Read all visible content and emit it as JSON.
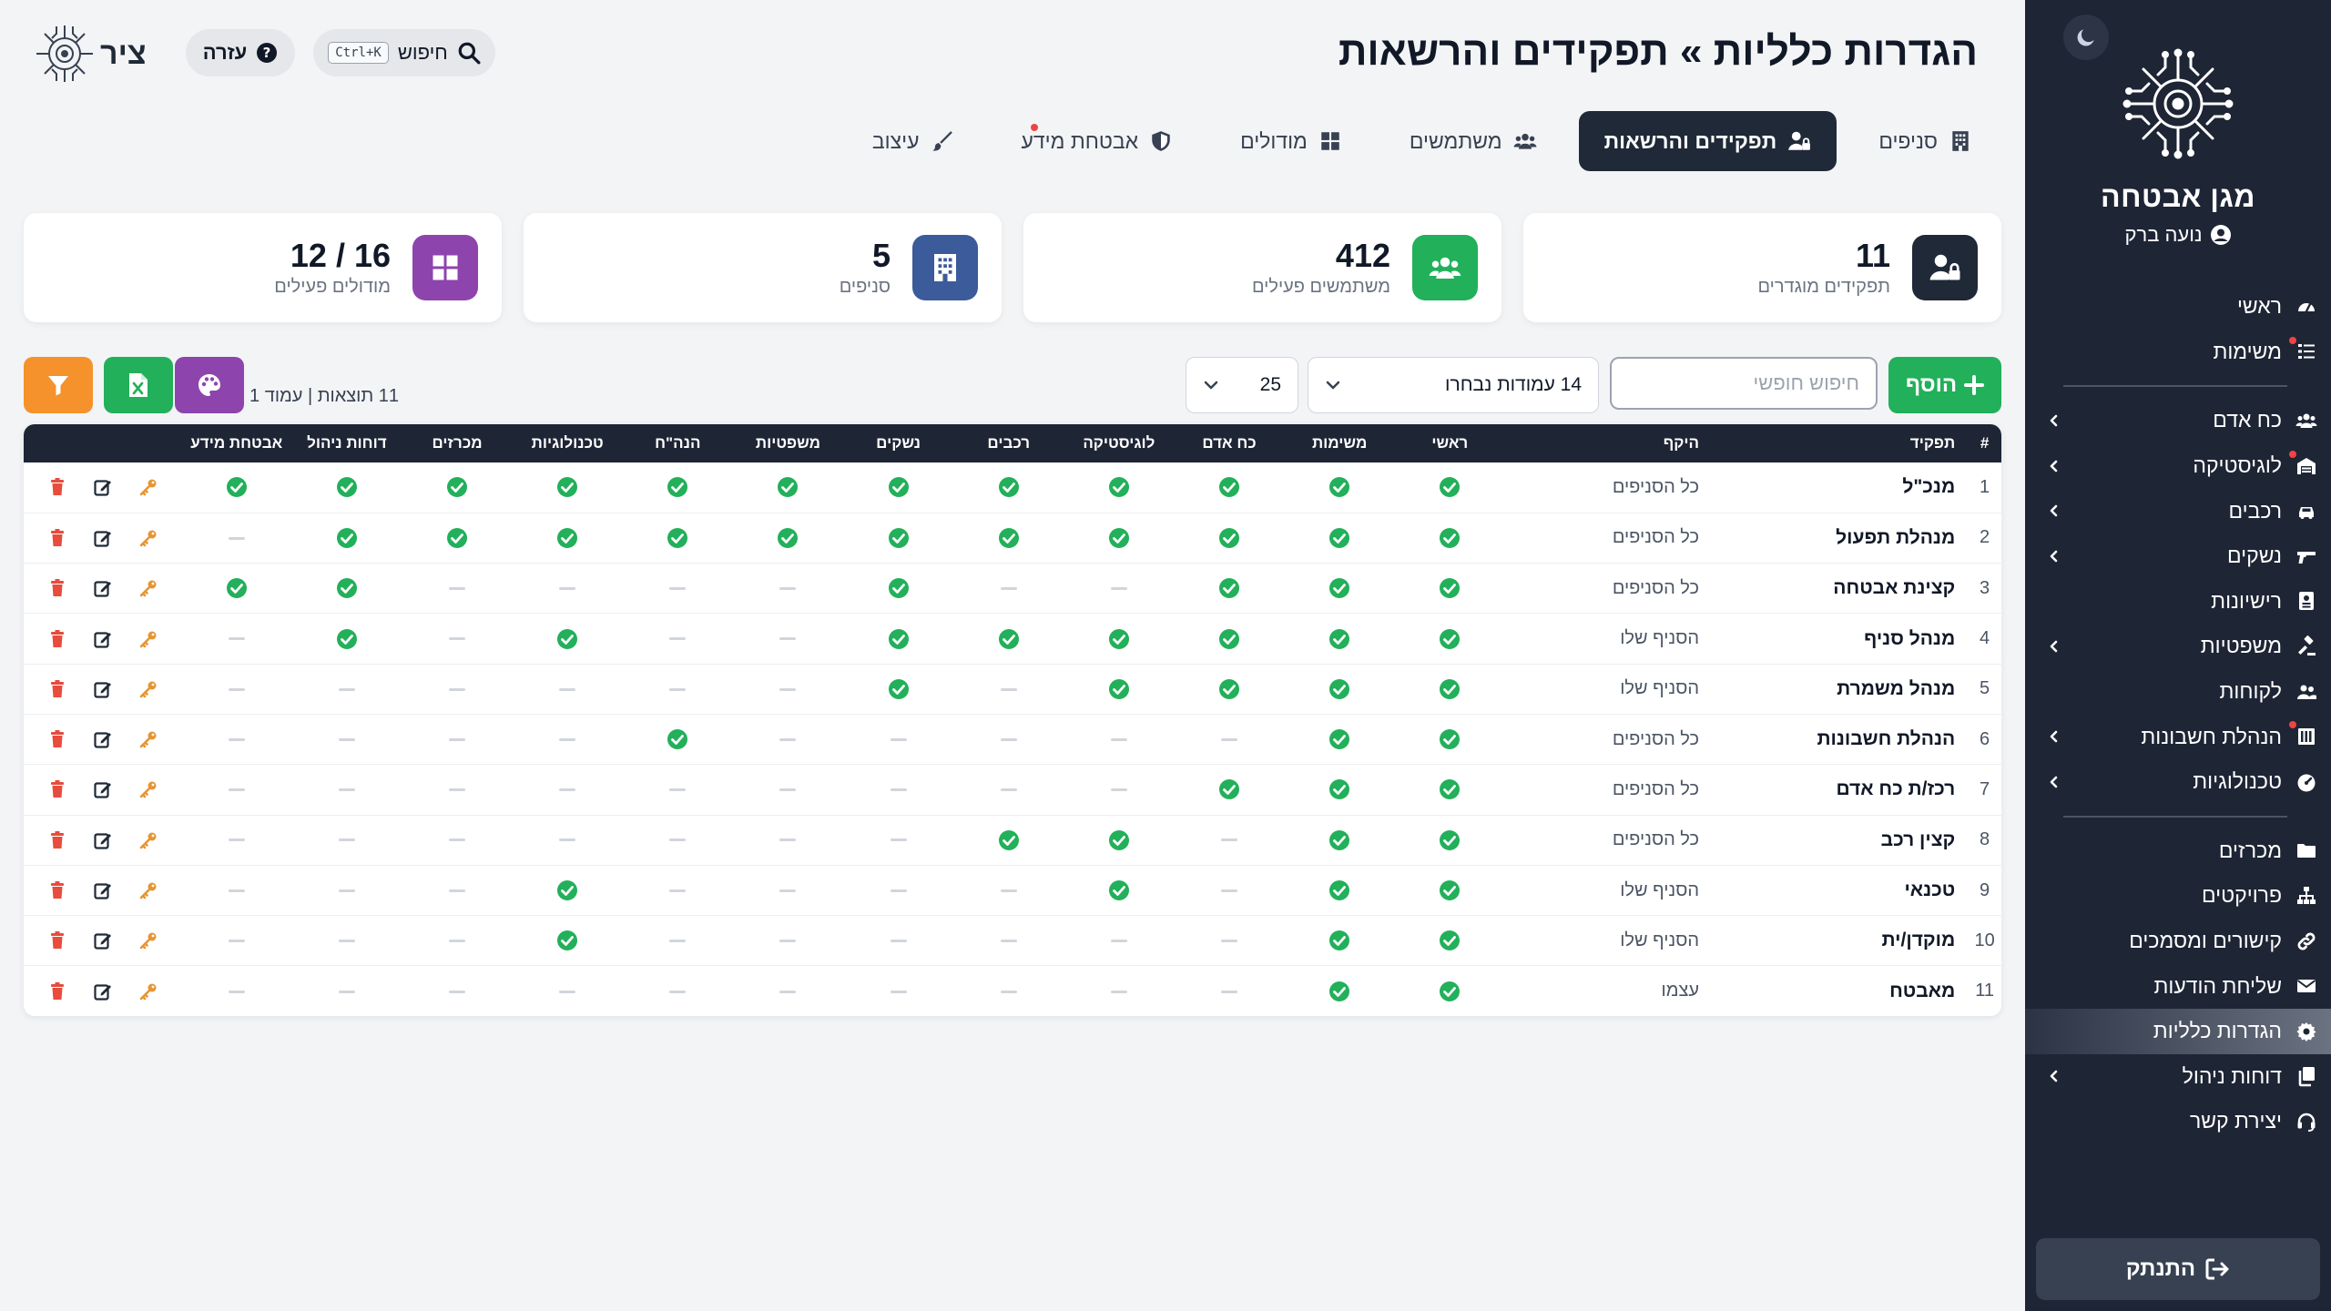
{
  "sidebar": {
    "brand_name": "מגן אבטחה",
    "user_name": "נועה ברק",
    "items": [
      {
        "label": "ראשי",
        "icon": "dashboard-icon",
        "chevron": false,
        "dot": false,
        "active": false
      },
      {
        "label": "משימות",
        "icon": "tasks-icon",
        "chevron": false,
        "dot": true,
        "active": false
      },
      {
        "sep": true
      },
      {
        "label": "כח אדם",
        "icon": "users-icon",
        "chevron": true,
        "dot": false,
        "active": false
      },
      {
        "label": "לוגיסטיקה",
        "icon": "warehouse-icon",
        "chevron": true,
        "dot": true,
        "active": false
      },
      {
        "label": "רכבים",
        "icon": "car-icon",
        "chevron": true,
        "dot": false,
        "active": false
      },
      {
        "label": "נשקים",
        "icon": "gun-icon",
        "chevron": true,
        "dot": false,
        "active": false
      },
      {
        "label": "רישיונות",
        "icon": "id-card-icon",
        "chevron": false,
        "dot": false,
        "active": false
      },
      {
        "label": "משפטיות",
        "icon": "gavel-icon",
        "chevron": true,
        "dot": false,
        "active": false
      },
      {
        "label": "לקוחות",
        "icon": "clients-icon",
        "chevron": false,
        "dot": false,
        "active": false
      },
      {
        "label": "הנהלת חשבונות",
        "icon": "ledger-icon",
        "chevron": true,
        "dot": true,
        "active": false
      },
      {
        "label": "טכנולוגיות",
        "icon": "gauge-icon",
        "chevron": true,
        "dot": false,
        "active": false
      },
      {
        "sep": true
      },
      {
        "label": "מכרזים",
        "icon": "folder-icon",
        "chevron": false,
        "dot": false,
        "active": false
      },
      {
        "label": "פרויקטים",
        "icon": "sitemap-icon",
        "chevron": false,
        "dot": false,
        "active": false
      },
      {
        "label": "קישורים ומסמכים",
        "icon": "link-icon",
        "chevron": false,
        "dot": false,
        "active": false
      },
      {
        "label": "שליחת הודעות",
        "icon": "envelope-icon",
        "chevron": false,
        "dot": false,
        "active": false
      },
      {
        "label": "הגדרות כלליות",
        "icon": "gear-icon",
        "chevron": false,
        "dot": false,
        "active": true
      },
      {
        "label": "דוחות ניהול",
        "icon": "copy-icon",
        "chevron": true,
        "dot": false,
        "active": false
      },
      {
        "label": "יצירת קשר",
        "icon": "headset-icon",
        "chevron": false,
        "dot": false,
        "active": false
      }
    ],
    "logout_label": "התנתק"
  },
  "header": {
    "title": "הגדרות כלליות » תפקידים והרשאות",
    "help_label": "עזרה",
    "search_label": "חיפוש",
    "search_shortcut": "Ctrl+K",
    "logo_word": "ציר"
  },
  "tabs": [
    {
      "label": "סניפים",
      "icon": "building-icon",
      "active": false,
      "dot": false
    },
    {
      "label": "תפקידים והרשאות",
      "icon": "user-lock-icon",
      "active": true,
      "dot": false
    },
    {
      "label": "משתמשים",
      "icon": "users-icon",
      "active": false,
      "dot": false
    },
    {
      "label": "מודולים",
      "icon": "grid-icon",
      "active": false,
      "dot": false
    },
    {
      "label": "אבטחת מידע",
      "icon": "shield-icon",
      "active": false,
      "dot": true
    },
    {
      "label": "עיצוב",
      "icon": "brush-icon",
      "active": false,
      "dot": false
    }
  ],
  "stats": [
    {
      "value": "11",
      "label": "תפקידים מוגדרים",
      "color": "#1f2937",
      "icon": "user-lock-icon"
    },
    {
      "value": "412",
      "label": "משתמשים פעילים",
      "color": "#22b05a",
      "icon": "users-icon"
    },
    {
      "value": "5",
      "label": "סניפים",
      "color": "#3b5b9a",
      "icon": "building-icon"
    },
    {
      "value": "16 / 12",
      "label": "מודולים פעילים",
      "color": "#8e44ad",
      "icon": "grid-icon"
    }
  ],
  "toolbar": {
    "add_label": "הוסף",
    "search_placeholder": "חיפוש חופשי",
    "columns_label": "14 עמודות נבחרו",
    "page_size": "25",
    "results_info": "11 תוצאות | עמוד 1"
  },
  "table": {
    "headers": {
      "num": "#",
      "role": "תפקיד",
      "scope": "היקף",
      "perms": [
        "ראשי",
        "משימות",
        "כח אדם",
        "לוגיסטיקה",
        "רכבים",
        "נשקים",
        "משפטיות",
        "הנה\"ח",
        "טכנולוגיות",
        "מכרזים",
        "דוחות ניהול",
        "אבטחת מידע"
      ]
    },
    "rows": [
      {
        "num": "1",
        "role": "מנכ\"ל",
        "scope": "כל הסניפים",
        "perms": [
          1,
          1,
          1,
          1,
          1,
          1,
          1,
          1,
          1,
          1,
          1,
          1
        ]
      },
      {
        "num": "2",
        "role": "מנהלת תפעול",
        "scope": "כל הסניפים",
        "perms": [
          1,
          1,
          1,
          1,
          1,
          1,
          1,
          1,
          1,
          1,
          1,
          0
        ]
      },
      {
        "num": "3",
        "role": "קצינת אבטחה",
        "scope": "כל הסניפים",
        "perms": [
          1,
          1,
          1,
          0,
          0,
          1,
          0,
          0,
          0,
          0,
          1,
          1
        ]
      },
      {
        "num": "4",
        "role": "מנהל סניף",
        "scope": "הסניף שלו",
        "perms": [
          1,
          1,
          1,
          1,
          1,
          1,
          0,
          0,
          1,
          0,
          1,
          0
        ]
      },
      {
        "num": "5",
        "role": "מנהל משמרת",
        "scope": "הסניף שלו",
        "perms": [
          1,
          1,
          1,
          1,
          0,
          1,
          0,
          0,
          0,
          0,
          0,
          0
        ]
      },
      {
        "num": "6",
        "role": "הנהלת חשבונות",
        "scope": "כל הסניפים",
        "perms": [
          1,
          1,
          0,
          0,
          0,
          0,
          0,
          1,
          0,
          0,
          0,
          0
        ]
      },
      {
        "num": "7",
        "role": "רכז/ת כח אדם",
        "scope": "כל הסניפים",
        "perms": [
          1,
          1,
          1,
          0,
          0,
          0,
          0,
          0,
          0,
          0,
          0,
          0
        ]
      },
      {
        "num": "8",
        "role": "קצין רכב",
        "scope": "כל הסניפים",
        "perms": [
          1,
          1,
          0,
          1,
          1,
          0,
          0,
          0,
          0,
          0,
          0,
          0
        ]
      },
      {
        "num": "9",
        "role": "טכנאי",
        "scope": "הסניף שלו",
        "perms": [
          1,
          1,
          0,
          1,
          0,
          0,
          0,
          0,
          1,
          0,
          0,
          0
        ]
      },
      {
        "num": "10",
        "role": "מוקדן/ית",
        "scope": "הסניף שלו",
        "perms": [
          1,
          1,
          0,
          0,
          0,
          0,
          0,
          0,
          1,
          0,
          0,
          0
        ]
      },
      {
        "num": "11",
        "role": "מאבטח",
        "scope": "עצמו",
        "perms": [
          1,
          1,
          0,
          0,
          0,
          0,
          0,
          0,
          0,
          0,
          0,
          0
        ]
      }
    ]
  },
  "colors": {
    "sidebar_bg": "#1e2535",
    "accent_green": "#22b05a",
    "accent_orange": "#f5922b",
    "accent_purple": "#8e44ad",
    "danger": "#e74c3c",
    "key": "#e69532"
  }
}
